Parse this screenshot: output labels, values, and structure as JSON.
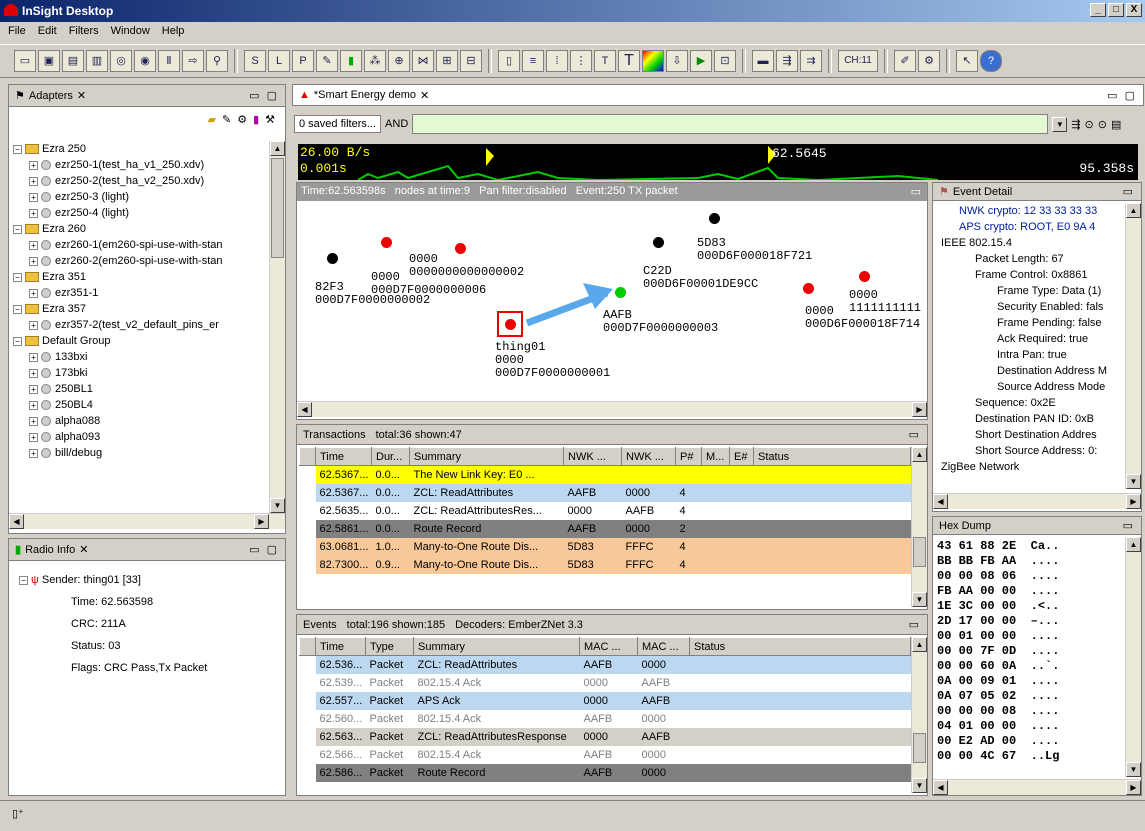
{
  "app": {
    "title": "InSight Desktop",
    "win_buttons": [
      "_",
      "□",
      "X"
    ]
  },
  "menu": [
    "File",
    "Edit",
    "Filters",
    "Window",
    "Help"
  ],
  "toolbar": {
    "channel": "CH:11"
  },
  "adapters": {
    "tab": "Adapters",
    "groups": [
      {
        "name": "Ezra 250",
        "items": [
          "ezr250-1(test_ha_v1_250.xdv)",
          "ezr250-2(test_ha_v2_250.xdv)",
          "ezr250-3 (light)",
          "ezr250-4 (light)"
        ]
      },
      {
        "name": "Ezra 260",
        "items": [
          "ezr260-1(em260-spi-use-with-stan",
          "ezr260-2(em260-spi-use-with-stan"
        ]
      },
      {
        "name": "Ezra 351",
        "items": [
          "ezr351-1"
        ]
      },
      {
        "name": "Ezra 357",
        "items": [
          "ezr357-2(test_v2_default_pins_er"
        ]
      },
      {
        "name": "Default Group",
        "items": [
          "133bxi",
          "173bki",
          "250BL1",
          "250BL4",
          "alpha088",
          "alpha093",
          "bill/debug"
        ]
      }
    ]
  },
  "radio": {
    "tab": "Radio Info",
    "sender": "Sender: thing01 [33]",
    "time": "Time: 62.563598",
    "crc": "CRC: 211A",
    "status": "Status: 03",
    "flags": "Flags: CRC Pass,Tx Packet"
  },
  "editor": {
    "tab": "*Smart Energy demo",
    "filter_btn": "0 saved filters...",
    "filter_op": "AND",
    "timeline": {
      "left_top": "26.00 B/s",
      "left_bottom": "0.001s",
      "marker": "62.5645",
      "right": "95.358s"
    }
  },
  "map": {
    "header": "Time:62.563598s   nodes at time:9   Pan filter:disabled   Event:250 TX packet",
    "nodes": [
      {
        "label": "82F3\n000D7F0000000002"
      },
      {
        "label": "0000\n000D7F0000000006"
      },
      {
        "label": "0000\n0000000000000002"
      },
      {
        "label": "5D83\n000D6F000018F721"
      },
      {
        "label": "C22D\n000D6F00001DE9CC"
      },
      {
        "label": "AAFB\n000D7F0000000003"
      },
      {
        "label": "thing01\n0000\n000D7F0000000001"
      },
      {
        "label": "0000\n000D6F000018F714"
      },
      {
        "label": "0000\n1111111111"
      }
    ]
  },
  "transactions": {
    "title": "Transactions",
    "total": "total:36 shown:47",
    "columns": [
      "Time",
      "Dur...",
      "Summary",
      "NWK ...",
      "NWK ...",
      "P#",
      "M...",
      "E#",
      "Status"
    ],
    "rows": [
      {
        "c": [
          "62.5367...",
          "0.0...",
          "The New Link Key: E0 ...",
          "",
          "",
          "",
          "",
          "",
          ""
        ],
        "bg": "#ffff00"
      },
      {
        "c": [
          "62.5367...",
          "0.0...",
          "ZCL: ReadAttributes",
          "AAFB",
          "0000",
          "4",
          "",
          "",
          ""
        ],
        "bg": "#bcd8f0"
      },
      {
        "c": [
          "62.5635...",
          "0.0...",
          "ZCL: ReadAttributesRes...",
          "0000",
          "AAFB",
          "4",
          "",
          "",
          ""
        ],
        "bg": "#ffffff"
      },
      {
        "c": [
          "62.5861...",
          "0.0...",
          "Route Record",
          "AAFB",
          "0000",
          "2",
          "",
          "",
          ""
        ],
        "bg": "#808080"
      },
      {
        "c": [
          "63.0681...",
          "1.0...",
          "Many-to-One Route Dis...",
          "5D83",
          "FFFC",
          "4",
          "",
          "",
          ""
        ],
        "bg": "#f8c898"
      },
      {
        "c": [
          "82.7300...",
          "0.9...",
          "Many-to-One Route Dis...",
          "5D83",
          "FFFC",
          "4",
          "",
          "",
          ""
        ],
        "bg": "#f8c898"
      }
    ]
  },
  "events": {
    "title": "Events",
    "total": "total:196 shown:185",
    "decoders": "Decoders: EmberZNet 3.3",
    "columns": [
      "Time",
      "Type",
      "Summary",
      "MAC ...",
      "MAC ...",
      "Status"
    ],
    "rows": [
      {
        "c": [
          "62.536...",
          "Packet",
          "ZCL: ReadAttributes",
          "AAFB",
          "0000",
          ""
        ],
        "bg": "#bcd8f0",
        "fg": "#000"
      },
      {
        "c": [
          "62.539...",
          "Packet",
          "802.15.4 Ack",
          "0000",
          "AAFB",
          ""
        ],
        "bg": "#ffffff",
        "fg": "#808080"
      },
      {
        "c": [
          "62.557...",
          "Packet",
          "APS Ack",
          "0000",
          "AAFB",
          ""
        ],
        "bg": "#bcd8f0",
        "fg": "#000"
      },
      {
        "c": [
          "62.560...",
          "Packet",
          "802.15.4 Ack",
          "AAFB",
          "0000",
          ""
        ],
        "bg": "#ffffff",
        "fg": "#808080"
      },
      {
        "c": [
          "62.563...",
          "Packet",
          "ZCL: ReadAttributesResponse",
          "0000",
          "AAFB",
          ""
        ],
        "bg": "#d4d0c8",
        "fg": "#000"
      },
      {
        "c": [
          "62.566...",
          "Packet",
          "802.15.4 Ack",
          "AAFB",
          "0000",
          ""
        ],
        "bg": "#ffffff",
        "fg": "#808080"
      },
      {
        "c": [
          "62.586...",
          "Packet",
          "Route Record",
          "AAFB",
          "0000",
          ""
        ],
        "bg": "#808080",
        "fg": "#000"
      }
    ]
  },
  "detail": {
    "title": "Event Detail",
    "rows": [
      "NWK crypto: 12 33 33 33 33",
      "APS crypto: ROOT, E0 9A 4",
      "IEEE 802.15.4",
      "Packet Length: 67",
      "Frame Control: 0x8861",
      "Frame Type: Data (1)",
      "Security Enabled: fals",
      "Frame Pending: false",
      "Ack Required: true",
      "Intra Pan: true",
      "Destination Address M",
      "Source Address Mode",
      "Sequence: 0x2E",
      "Destination PAN ID: 0xB",
      "Short Destination Addres",
      "Short Source Address: 0:",
      "ZigBee Network"
    ]
  },
  "hex": {
    "title": "Hex Dump",
    "rows": [
      [
        "43 61 88 2E",
        "Ca.."
      ],
      [
        "BB BB FB AA",
        "...."
      ],
      [
        "00 00 08 06",
        "...."
      ],
      [
        "FB AA 00 00",
        "...."
      ],
      [
        "1E 3C 00 00",
        ".<.."
      ],
      [
        "2D 17 00 00",
        "–..."
      ],
      [
        "00 01 00 00",
        "...."
      ],
      [
        "00 00 7F 0D",
        "...."
      ],
      [
        "00 00 60 0A",
        "..`."
      ],
      [
        "0A 00 09 01",
        "...."
      ],
      [
        "0A 07 05 02",
        "...."
      ],
      [
        "00 00 00 08",
        "...."
      ],
      [
        "04 01 00 00",
        "...."
      ],
      [
        "00 E2 AD 00",
        "...."
      ],
      [
        "00 00 4C 67",
        "..Lg"
      ]
    ]
  }
}
